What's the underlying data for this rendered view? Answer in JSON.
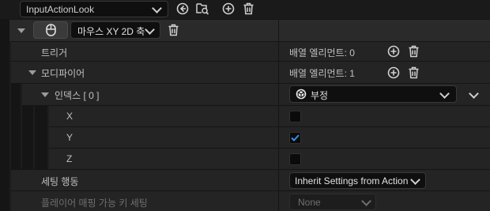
{
  "header": {
    "asset_name": "InputActionLook"
  },
  "key_row": {
    "key_name": "마우스 XY 2D 축"
  },
  "triggers": {
    "label": "트리거",
    "count_text": "배열 엘리먼트: 0"
  },
  "modifiers": {
    "label": "모디파이어",
    "count_text": "배열 엘리먼트: 1"
  },
  "index0": {
    "label": "인덱스 [ 0 ]",
    "value": "부정"
  },
  "axes": [
    {
      "label": "X",
      "checked": false
    },
    {
      "label": "Y",
      "checked": true
    },
    {
      "label": "Z",
      "checked": false
    }
  ],
  "settings_behavior": {
    "label": "세팅 행동",
    "value": "Inherit Settings from Action"
  },
  "player_settings": {
    "label": "플레이어 매핑 가능 키 세팅",
    "value": "None"
  },
  "colors": {
    "accent": "#3a8fe0",
    "panel": "#242424",
    "background": "#151515"
  }
}
